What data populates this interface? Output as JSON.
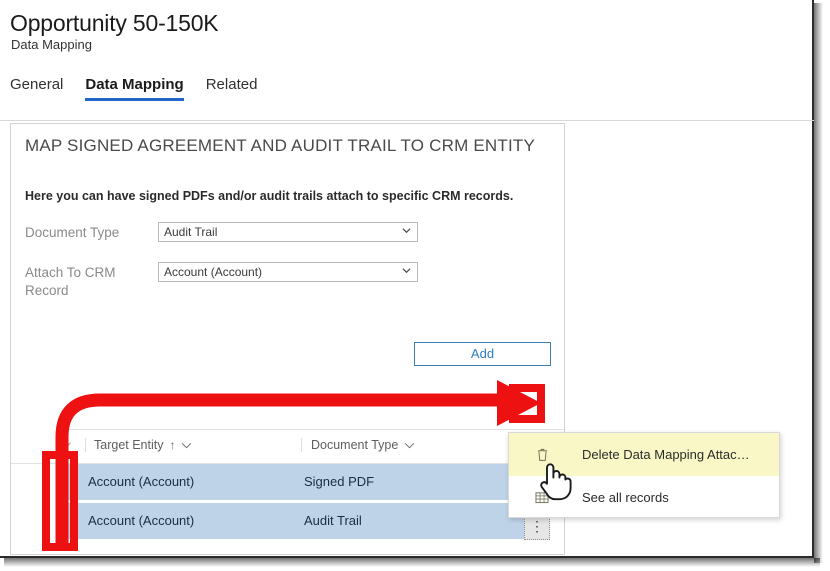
{
  "header": {
    "title": "Opportunity 50-150K",
    "subtitle": "Data Mapping"
  },
  "tabs": [
    {
      "label": "General",
      "active": false
    },
    {
      "label": "Data Mapping",
      "active": true
    },
    {
      "label": "Related",
      "active": false
    }
  ],
  "card": {
    "title": "MAP SIGNED AGREEMENT AND AUDIT TRAIL TO CRM ENTITY",
    "description": "Here you can have signed PDFs and/or audit trails attach to specific CRM records.",
    "fields": [
      {
        "label": "Document Type",
        "value": "Audit Trail"
      },
      {
        "label": "Attach To CRM Record",
        "value": "Account (Account)"
      }
    ],
    "add_button": "Add",
    "overflow_button": "⋮"
  },
  "grid": {
    "select_all_glyph": "✓",
    "columns": [
      {
        "label": "Target Entity",
        "sort": "↑"
      },
      {
        "label": "Document Type",
        "sort": ""
      }
    ],
    "rows": [
      {
        "checked": "✓",
        "target_entity": "Account (Account)",
        "document_type": "Signed PDF",
        "selected": true
      },
      {
        "checked": "✓",
        "target_entity": "Account (Account)",
        "document_type": "Audit Trail",
        "selected": true
      }
    ]
  },
  "context_menu": {
    "items": [
      {
        "label": "Delete Data Mapping Attac…",
        "icon": "trash-icon",
        "highlighted": true
      },
      {
        "label": "See all records",
        "icon": "grid-table-icon",
        "highlighted": false
      }
    ]
  },
  "annotation": {
    "color": "#ee1111",
    "arrow_description": "curved arrow from row checkboxes to overflow menu button"
  },
  "colors": {
    "accent": "#2266cc",
    "link": "#2e7fbf",
    "row_selected": "#bfd3e8",
    "menu_highlight": "#faf7c6",
    "annotation_red": "#ee1111"
  }
}
